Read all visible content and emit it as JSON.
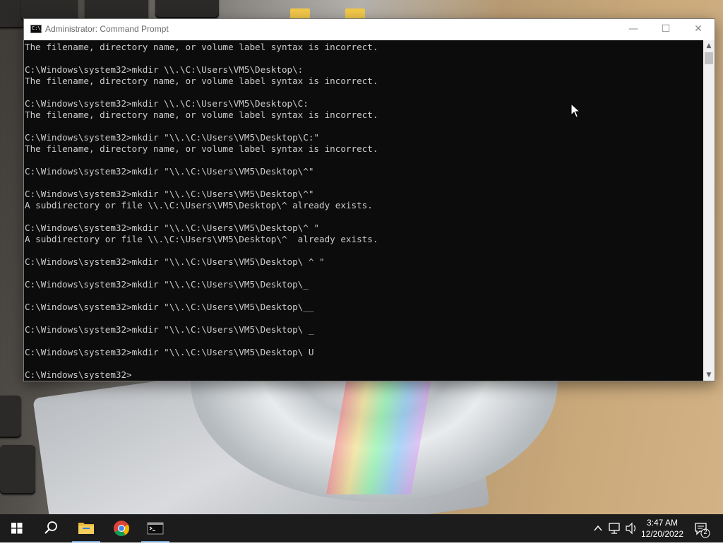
{
  "window": {
    "title": "Administrator: Command Prompt",
    "icon_label": "C:\\_",
    "minimize_glyph": "—",
    "maximize_glyph": "☐",
    "close_glyph": "✕"
  },
  "console": {
    "lines": [
      "The filename, directory name, or volume label syntax is incorrect.",
      "",
      "C:\\Windows\\system32>mkdir \\\\.\\C:\\Users\\VM5\\Desktop\\:",
      "The filename, directory name, or volume label syntax is incorrect.",
      "",
      "C:\\Windows\\system32>mkdir \\\\.\\C:\\Users\\VM5\\Desktop\\C:",
      "The filename, directory name, or volume label syntax is incorrect.",
      "",
      "C:\\Windows\\system32>mkdir \"\\\\.\\C:\\Users\\VM5\\Desktop\\C:\"",
      "The filename, directory name, or volume label syntax is incorrect.",
      "",
      "C:\\Windows\\system32>mkdir \"\\\\.\\C:\\Users\\VM5\\Desktop\\^\"",
      "",
      "C:\\Windows\\system32>mkdir \"\\\\.\\C:\\Users\\VM5\\Desktop\\^\"",
      "A subdirectory or file \\\\.\\C:\\Users\\VM5\\Desktop\\^ already exists.",
      "",
      "C:\\Windows\\system32>mkdir \"\\\\.\\C:\\Users\\VM5\\Desktop\\^ \"",
      "A subdirectory or file \\\\.\\C:\\Users\\VM5\\Desktop\\^  already exists.",
      "",
      "C:\\Windows\\system32>mkdir \"\\\\.\\C:\\Users\\VM5\\Desktop\\ ^ \"",
      "",
      "C:\\Windows\\system32>mkdir \"\\\\.\\C:\\Users\\VM5\\Desktop\\_",
      "",
      "C:\\Windows\\system32>mkdir \"\\\\.\\C:\\Users\\VM5\\Desktop\\__",
      "",
      "C:\\Windows\\system32>mkdir \"\\\\.\\C:\\Users\\VM5\\Desktop\\ _",
      "",
      "C:\\Windows\\system32>mkdir \"\\\\.\\C:\\Users\\VM5\\Desktop\\ U",
      "",
      "C:\\Windows\\system32>"
    ],
    "text_color": "#cccccc",
    "background": "#0c0c0c"
  },
  "scrollbar": {
    "up_glyph": "▲",
    "down_glyph": "▼"
  },
  "taskbar": {
    "items": [
      {
        "name": "windows-start-icon"
      },
      {
        "name": "search-icon"
      },
      {
        "name": "file-explorer-icon"
      },
      {
        "name": "chrome-icon"
      },
      {
        "name": "command-prompt-icon"
      }
    ],
    "tray": {
      "chevron_glyph": "^",
      "notification_count": "2"
    },
    "clock": {
      "time": "3:47 AM",
      "date": "12/20/2022"
    }
  }
}
